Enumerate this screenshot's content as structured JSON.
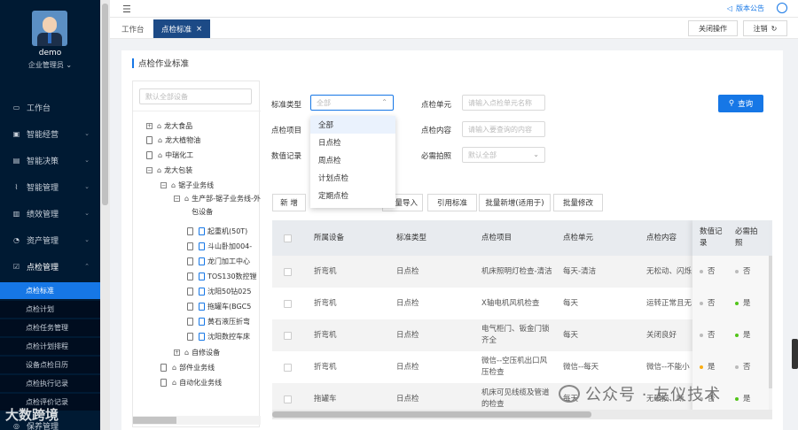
{
  "user": {
    "name": "demo",
    "role": "企业管理员"
  },
  "sidebar": {
    "menu": [
      {
        "icon": "monitor-icon",
        "label": "工作台"
      },
      {
        "icon": "chart-bar-icon",
        "label": "智能经营"
      },
      {
        "icon": "bar-chart-icon",
        "label": "智能决策"
      },
      {
        "icon": "line-chart-icon",
        "label": "智能管理"
      },
      {
        "icon": "performance-icon",
        "label": "绩效管理"
      },
      {
        "icon": "asset-icon",
        "label": "资产管理"
      },
      {
        "icon": "checkbox-icon",
        "label": "点检管理"
      }
    ],
    "submenu": [
      "点检标准",
      "点检计划",
      "点检任务管理",
      "点检计划排程",
      "设备点检日历",
      "点检执行记录",
      "点检评价记录"
    ],
    "last_item": "保养管理"
  },
  "watermark_left": "大数跨境",
  "watermark_right": "公众号 · 友仪技术",
  "topbar": {
    "notice": "版本公告"
  },
  "tabs": {
    "items": [
      "工作台",
      "点检标准"
    ],
    "close_ops": "关闭操作",
    "logout": "注销"
  },
  "panel": {
    "title": "点检作业标准"
  },
  "tree": {
    "search_placeholder": "默认全部设备",
    "nodes": [
      "龙大食品",
      "龙大植物油",
      "中瑞化工",
      "龙大包装",
      "锯子业务线",
      "生产部-锯子业务线-外包设备",
      "起重机(50T)",
      "斗山卧加004-",
      "龙门加工中心",
      "TOS130数控镗",
      "沈阳50钻025",
      "拖罐车(BGC5",
      "黄石液压折弯",
      "沈阳数控车床",
      "自修设备",
      "部件业务线",
      "自动化业务线"
    ]
  },
  "filters": {
    "std_type_label": "标准类型",
    "std_type_value": "全部",
    "unit_label": "点检单元",
    "unit_placeholder": "请输入点检单元名称",
    "project_label": "点检项目",
    "content_label": "点检内容",
    "content_placeholder": "请输入要查询的内容",
    "value_label": "数值记录",
    "photo_label": "必需拍照",
    "photo_value": "默认全部",
    "query": "查询"
  },
  "dropdown": [
    "全部",
    "日点检",
    "周点检",
    "计划点检",
    "定期点检"
  ],
  "actions": [
    "新 增",
    "批量导入",
    "引用标准",
    "批量新增(适用于)",
    "批量修改"
  ],
  "table": {
    "headers": [
      "所属设备",
      "标准类型",
      "点检项目",
      "点检单元",
      "点检内容",
      "数值记录",
      "必需拍照"
    ],
    "rows": [
      {
        "device": "折弯机",
        "type": "日点检",
        "project": "机床照明灯检查-清洁",
        "unit": "每天-清洁",
        "content": "无松动、闪烁",
        "num": "否",
        "num_color": "#bbbbbb",
        "photo": "否",
        "photo_color": "#bbbbbb"
      },
      {
        "device": "折弯机",
        "type": "日点检",
        "project": "X轴电机风机检查",
        "unit": "每天",
        "content": "运转正常且无",
        "num": "否",
        "num_color": "#bbbbbb",
        "photo": "是",
        "photo_color": "#52c41a"
      },
      {
        "device": "折弯机",
        "type": "日点检",
        "project": "电气柜门、钣金门锁齐全",
        "unit": "每天",
        "content": "关闭良好",
        "num": "否",
        "num_color": "#bbbbbb",
        "photo": "是",
        "photo_color": "#52c41a"
      },
      {
        "device": "折弯机",
        "type": "日点检",
        "project": "微信--空压机出口风压检查",
        "unit": "微信--每天",
        "content": "微信--不能小",
        "num": "是",
        "num_color": "#faad14",
        "photo": "否",
        "photo_color": "#bbbbbb"
      },
      {
        "device": "拖罐车",
        "type": "日点检",
        "project": "机床可见线缆及管道的检查",
        "unit": "每天",
        "content": "无破损、断",
        "num": "否",
        "num_color": "#bbbbbb",
        "photo": "是",
        "photo_color": "#52c41a"
      }
    ]
  }
}
